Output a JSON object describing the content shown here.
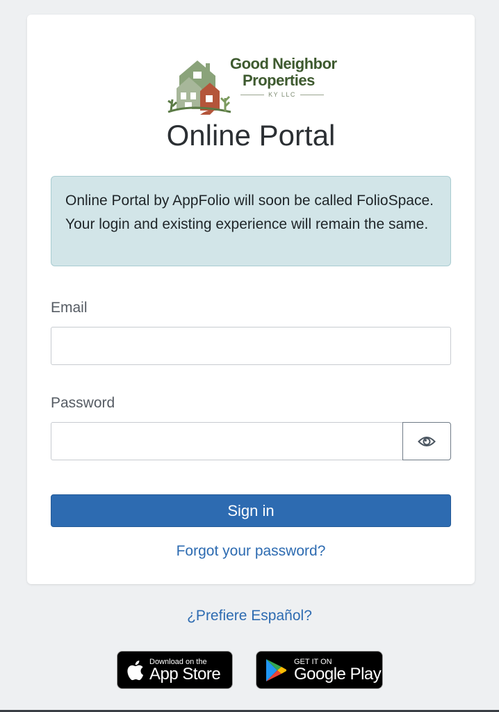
{
  "logo": {
    "line1": "Good Neighbor",
    "line2": "Properties",
    "sub": "KY LLC"
  },
  "title": "Online Portal",
  "notice": "Online Portal by AppFolio will soon be called FolioSpace. Your login and existing experience will remain the same.",
  "form": {
    "email_label": "Email",
    "email_value": "",
    "password_label": "Password",
    "password_value": "",
    "toggle_icon": "eye-icon",
    "signin_label": "Sign in",
    "forgot_label": "Forgot your password?"
  },
  "language_link": "¿Prefiere Español?",
  "stores": {
    "apple": {
      "small": "Download on the",
      "big": "App Store"
    },
    "google": {
      "small": "GET IT ON",
      "big": "Google Play"
    }
  },
  "colors": {
    "accent": "#2d6bb1",
    "notice_bg": "#d2e5e8",
    "page_bg": "#eef0f2",
    "logo_green": "#3e5a2f"
  }
}
